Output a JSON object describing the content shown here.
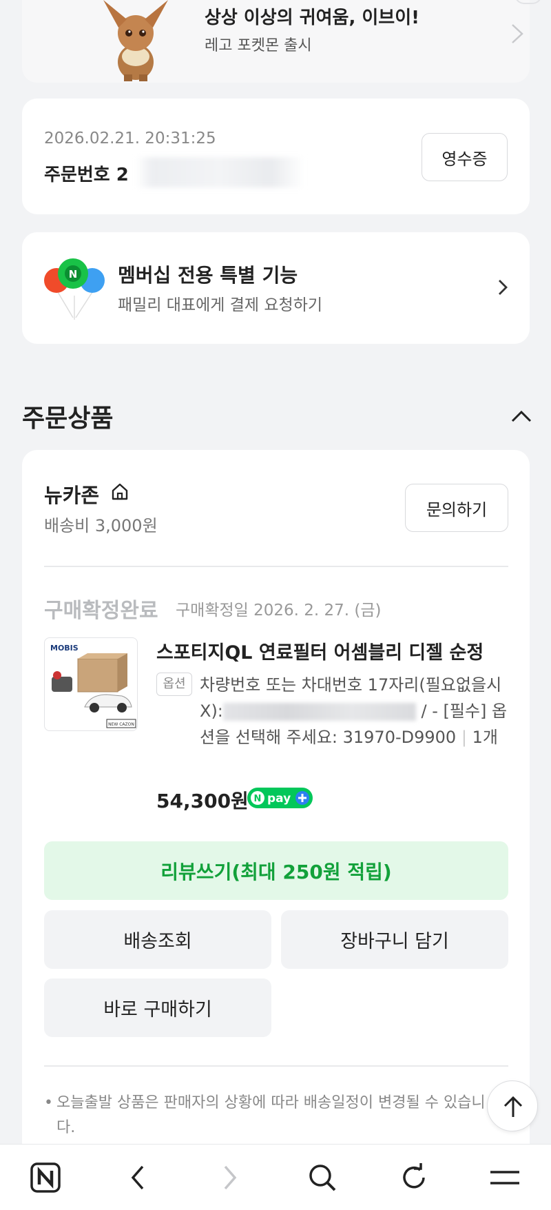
{
  "banner": {
    "title": "상상 이상의 귀여움, 이브이!",
    "subtitle": "레고 포켓몬 출시"
  },
  "order": {
    "date": "2026.02.21. 20:31:25",
    "number_label": "주문번호 2",
    "receipt_label": "영수증"
  },
  "membership": {
    "title": "멤버십 전용 특별 기능",
    "subtitle": "패밀리 대표에게 결제 요청하기"
  },
  "section": {
    "title": "주문상품"
  },
  "seller": {
    "name": "뉴카존",
    "shipping_fee": "배송비 3,000원",
    "inquiry_label": "문의하기"
  },
  "item": {
    "status": "구매확정완료",
    "status_date": "구매확정일 2026. 2. 27. (금)",
    "thumb_brand": "MOBIS",
    "thumb_corner": "NEW CAZON",
    "name": "스포티지QL 연료필터 어셈블리 디젤 순정",
    "option_badge": "옵션",
    "option_part1": "차량번호 또는 차대번호 17자리(필요없을시X):",
    "option_part2": " / - [필수] 옵션을 선택해 주세요: 31970-D9900",
    "quantity": "1개",
    "price": "54,300원",
    "npay_text": "pay"
  },
  "actions": {
    "review": "리뷰쓰기(최대 250원 적립)",
    "track": "배송조회",
    "cart": "장바구니 담기",
    "buy": "바로 구매하기"
  },
  "notice": {
    "text": "오늘출발 상품은 판매자의 상황에 따라 배송일정이 변경될 수 있습니다."
  },
  "colors": {
    "accent_green": "#12a13a",
    "review_bg": "#e3f8e8",
    "page_bg": "#f2f3f5"
  },
  "nav_icons": [
    "naver-home-icon",
    "back-icon",
    "forward-icon",
    "search-icon",
    "refresh-icon",
    "menu-icon"
  ]
}
